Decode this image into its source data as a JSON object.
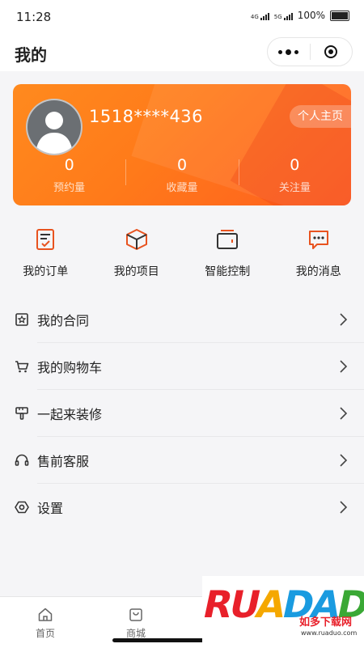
{
  "status_bar": {
    "time": "11:28",
    "network_1": "4G",
    "network_2": "5G",
    "battery": "100%"
  },
  "nav": {
    "title": "我的"
  },
  "profile": {
    "phone": "1518****436",
    "homepage_label": "个人主页",
    "stats": [
      {
        "value": "0",
        "label": "预约量"
      },
      {
        "value": "0",
        "label": "收藏量"
      },
      {
        "value": "0",
        "label": "关注量"
      }
    ]
  },
  "quick_actions": [
    {
      "label": "我的订单",
      "icon": "order-icon"
    },
    {
      "label": "我的项目",
      "icon": "project-icon"
    },
    {
      "label": "智能控制",
      "icon": "control-icon"
    },
    {
      "label": "我的消息",
      "icon": "message-icon"
    }
  ],
  "menu": [
    {
      "label": "我的合同",
      "icon": "contract-icon"
    },
    {
      "label": "我的购物车",
      "icon": "cart-icon"
    },
    {
      "label": "一起来装修",
      "icon": "paint-brush-icon"
    },
    {
      "label": "售前客服",
      "icon": "headset-icon"
    },
    {
      "label": "设置",
      "icon": "settings-icon"
    }
  ],
  "tabbar": [
    {
      "label": "首页",
      "icon": "home-icon"
    },
    {
      "label": "商城",
      "icon": "shop-bag-icon"
    }
  ],
  "watermark": {
    "letters": [
      "RU",
      "A",
      "DA",
      "DO"
    ],
    "cn": "如多下载网",
    "url": "www.ruaduo.com"
  },
  "colors": {
    "accent": "#ff7a1a",
    "icon": "#e8531f"
  }
}
